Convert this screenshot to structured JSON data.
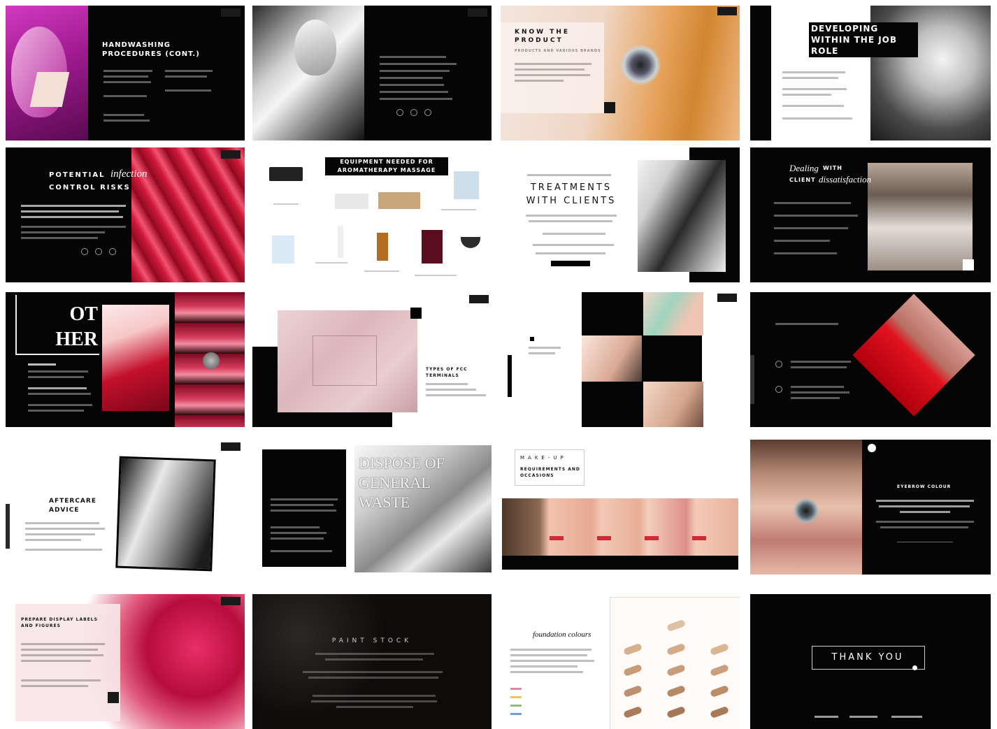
{
  "slides": [
    {
      "title": "HANDWASHING PROCEDURES (CONT.)"
    },
    {
      "title": ""
    },
    {
      "title": "KNOW THE PRODUCT",
      "subtitle": "PRODUCTS AND VARIOUS BRANDS"
    },
    {
      "title": "DEVELOPING WITHIN THE JOB ROLE"
    },
    {
      "title_a": "POTENTIAL",
      "title_b": "infection",
      "title_c": "CONTROL RISKS"
    },
    {
      "title": "EQUIPMENT NEEDED FOR AROMATHERAPY MASSAGE"
    },
    {
      "title": "TREATMENTS WITH CLIENTS"
    },
    {
      "title_a": "Dealing",
      "title_b": "WITH",
      "title_c": "CLIENT",
      "title_d": "dissatisfaction"
    },
    {
      "title": "OT HER"
    },
    {
      "title": "TYPES OF FCC TERMINALS"
    },
    {
      "title": ""
    },
    {
      "title": ""
    },
    {
      "title": "AFTERCARE ADVICE"
    },
    {
      "title": "DISPOSE OF GENERAL WASTE"
    },
    {
      "title_a": "MAKE-UP",
      "title_b": "REQUIREMENTS AND OCCASIONS"
    },
    {
      "title": "EYEBROW COLOUR"
    },
    {
      "title": "PREPARE DISPLAY LABELS AND FIGURES"
    },
    {
      "title": "PAINT STOCK"
    },
    {
      "title": "foundation colours"
    },
    {
      "title": "THANK YOU"
    }
  ],
  "colors": {
    "magenta": "#a0168f",
    "lipstick_red": "#c8102e",
    "rose": "#e8a4b8",
    "skin": "#e9b089",
    "dark": "#050505"
  }
}
